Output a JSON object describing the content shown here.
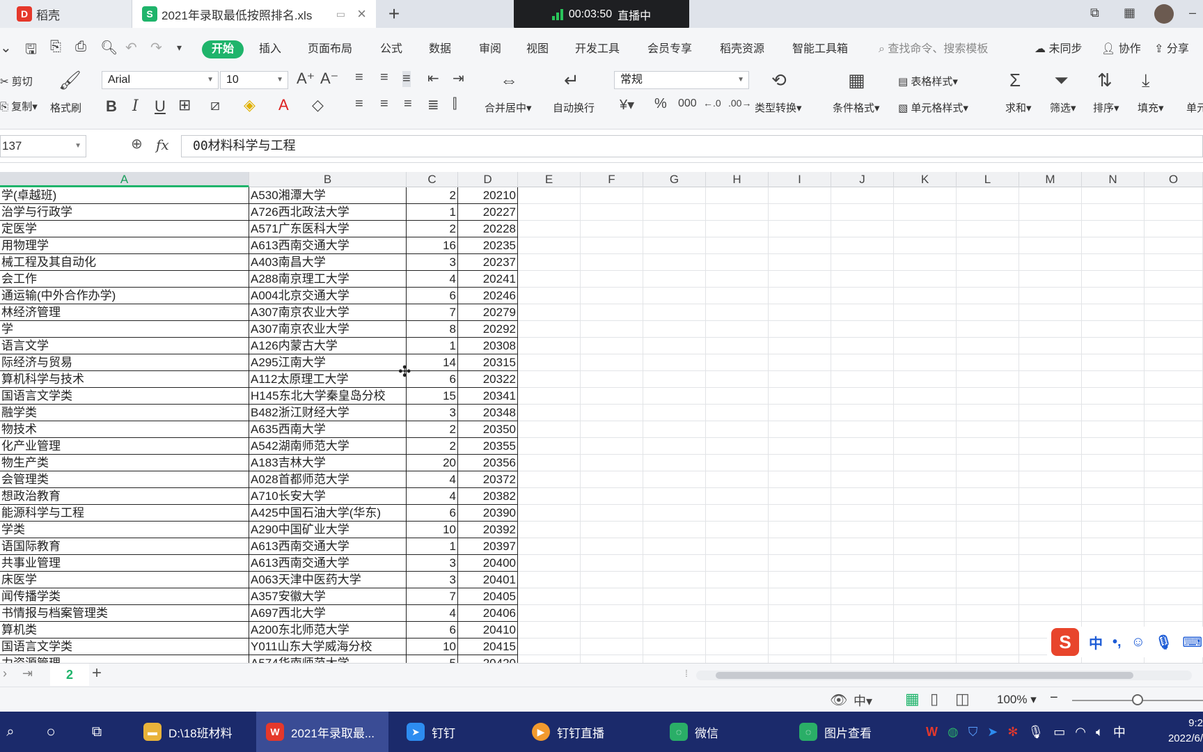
{
  "tabs": {
    "tab1": "稻壳",
    "tab2": "2021年录取最低按照排名.xls",
    "new_tab": "+"
  },
  "live": {
    "time": "00:03:50",
    "status": "直播中"
  },
  "menu": {
    "start": "开始",
    "insert": "插入",
    "layout": "页面布局",
    "formula": "公式",
    "data": "数据",
    "review": "审阅",
    "view": "视图",
    "dev": "开发工具",
    "member": "会员专享",
    "docer": "稻壳资源",
    "ai": "智能工具箱",
    "search": "查找命令、搜索模板",
    "unsynced": "未同步",
    "collab": "协作",
    "share": "分享"
  },
  "ribbon": {
    "cut": "剪切",
    "copy": "复制",
    "painter": "格式刷",
    "font": "Arial",
    "size": "10",
    "merge": "合并居中",
    "wrap": "自动换行",
    "numfmt": "常规",
    "convert": "类型转换",
    "cond": "条件格式",
    "tablestyle": "表格样式",
    "cellstyle": "单元格样式",
    "sum": "求和",
    "filter": "筛选",
    "sort": "排序",
    "fill": "填充",
    "more": "单元"
  },
  "formula_bar": {
    "name_box": "137",
    "fx": "fx",
    "content": "00材料科学与工程"
  },
  "columns": [
    "A",
    "B",
    "C",
    "D",
    "E",
    "F",
    "G",
    "H",
    "I",
    "J",
    "K",
    "L",
    "M",
    "N",
    "O"
  ],
  "rows": [
    {
      "a": "学(卓越班)",
      "b": "A530湘潭大学",
      "c": "2",
      "d": "20210"
    },
    {
      "a": "治学与行政学",
      "b": "A726西北政法大学",
      "c": "1",
      "d": "20227"
    },
    {
      "a": "定医学",
      "b": "A571广东医科大学",
      "c": "2",
      "d": "20228"
    },
    {
      "a": "用物理学",
      "b": "A613西南交通大学",
      "c": "16",
      "d": "20235"
    },
    {
      "a": "械工程及其自动化",
      "b": "A403南昌大学",
      "c": "3",
      "d": "20237"
    },
    {
      "a": "会工作",
      "b": "A288南京理工大学",
      "c": "4",
      "d": "20241"
    },
    {
      "a": "通运输(中外合作办学)",
      "b": "A004北京交通大学",
      "c": "6",
      "d": "20246"
    },
    {
      "a": "林经济管理",
      "b": "A307南京农业大学",
      "c": "7",
      "d": "20279"
    },
    {
      "a": "学",
      "b": "A307南京农业大学",
      "c": "8",
      "d": "20292"
    },
    {
      "a": "语言文学",
      "b": "A126内蒙古大学",
      "c": "1",
      "d": "20308"
    },
    {
      "a": "际经济与贸易",
      "b": "A295江南大学",
      "c": "14",
      "d": "20315"
    },
    {
      "a": "算机科学与技术",
      "b": "A112太原理工大学",
      "c": "6",
      "d": "20322"
    },
    {
      "a": "国语言文学类",
      "b": "H145东北大学秦皇岛分校",
      "c": "15",
      "d": "20341"
    },
    {
      "a": "融学类",
      "b": "B482浙江财经大学",
      "c": "3",
      "d": "20348"
    },
    {
      "a": "物技术",
      "b": "A635西南大学",
      "c": "2",
      "d": "20350"
    },
    {
      "a": "化产业管理",
      "b": "A542湖南师范大学",
      "c": "2",
      "d": "20355"
    },
    {
      "a": "物生产类",
      "b": "A183吉林大学",
      "c": "20",
      "d": "20356"
    },
    {
      "a": "会管理类",
      "b": "A028首都师范大学",
      "c": "4",
      "d": "20372"
    },
    {
      "a": "想政治教育",
      "b": "A710长安大学",
      "c": "4",
      "d": "20382"
    },
    {
      "a": "能源科学与工程",
      "b": "A425中国石油大学(华东)",
      "c": "6",
      "d": "20390"
    },
    {
      "a": "学类",
      "b": "A290中国矿业大学",
      "c": "10",
      "d": "20392"
    },
    {
      "a": "语国际教育",
      "b": "A613西南交通大学",
      "c": "1",
      "d": "20397"
    },
    {
      "a": "共事业管理",
      "b": "A613西南交通大学",
      "c": "3",
      "d": "20400"
    },
    {
      "a": "床医学",
      "b": "A063天津中医药大学",
      "c": "3",
      "d": "20401"
    },
    {
      "a": "闻传播学类",
      "b": "A357安徽大学",
      "c": "7",
      "d": "20405"
    },
    {
      "a": "书情报与档案管理类",
      "b": "A697西北大学",
      "c": "4",
      "d": "20406"
    },
    {
      "a": "算机类",
      "b": "A200东北师范大学",
      "c": "6",
      "d": "20410"
    },
    {
      "a": "国语言文学类",
      "b": "Y011山东大学威海分校",
      "c": "10",
      "d": "20415"
    },
    {
      "a": "力资源管理",
      "b": "A574华南师范大学",
      "c": "5",
      "d": "20420"
    }
  ],
  "sheet": {
    "name": "2",
    "add": "+"
  },
  "status": {
    "zoom": "100%",
    "ime": "中"
  },
  "taskbar": {
    "folder": "D:\\18班材料",
    "wps": "2021年录取最...",
    "dingtalk": "钉钉",
    "dinglive": "钉钉直播",
    "wechat": "微信",
    "photo": "图片查看",
    "tray_lang": "中",
    "clock_time": "9:2",
    "clock_date": "2022/6/"
  },
  "ime_bar": {
    "logo": "S",
    "lang": "中"
  },
  "colors": {
    "accent": "#1fb46b",
    "taskbar": "#1b2a6b"
  }
}
